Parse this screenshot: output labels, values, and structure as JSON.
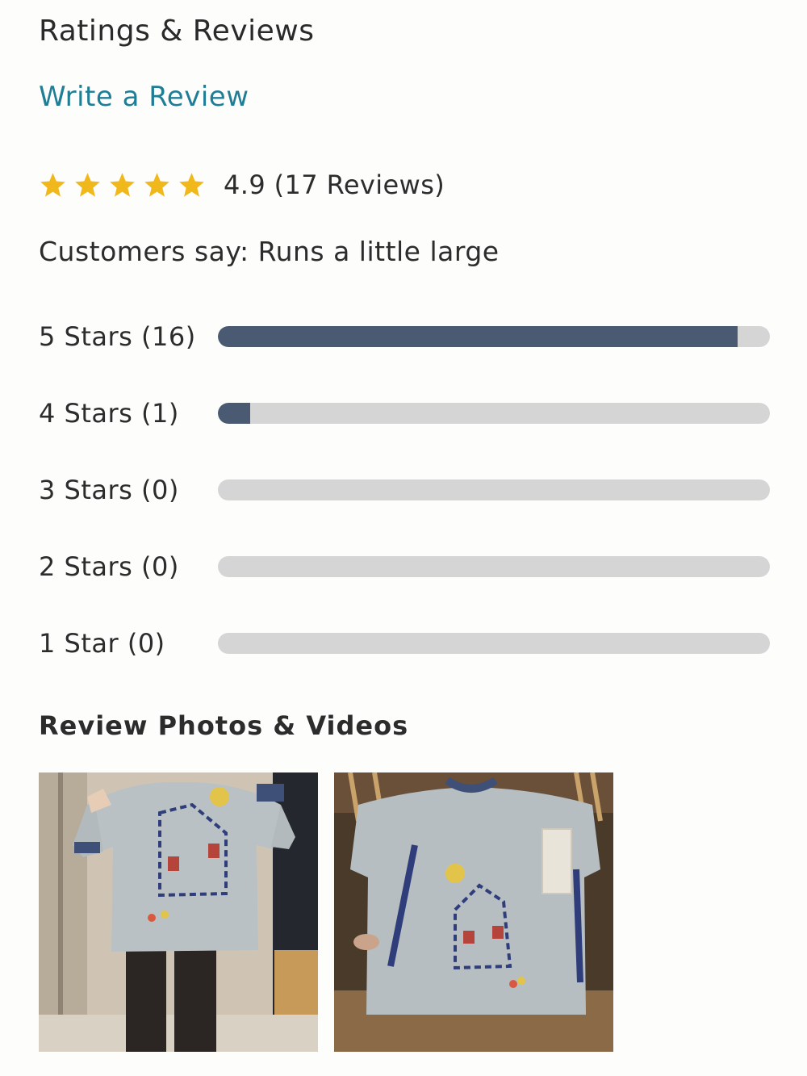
{
  "header": {
    "title": "Ratings & Reviews",
    "write_review_label": "Write a Review"
  },
  "rating": {
    "average": 4.9,
    "stars_filled": 5,
    "summary_text": "4.9 (17 Reviews)",
    "star_color": "#f0b81a"
  },
  "fit": {
    "text": "Customers say: Runs a little large"
  },
  "distribution": {
    "total": 17,
    "bar_color": "#4a5a72",
    "track_color": "#d5d5d5",
    "rows": [
      {
        "label": "5 Stars (16)",
        "stars": 5,
        "count": 16
      },
      {
        "label": "4 Stars (1)",
        "stars": 4,
        "count": 1
      },
      {
        "label": "3 Stars (0)",
        "stars": 3,
        "count": 0
      },
      {
        "label": "2 Stars (0)",
        "stars": 2,
        "count": 0
      },
      {
        "label": "1 Star (0)",
        "stars": 1,
        "count": 0
      }
    ]
  },
  "media": {
    "heading": "Review Photos & Videos",
    "photos": [
      {
        "name": "review-photo-worn-sweater"
      },
      {
        "name": "review-photo-sweater-on-hanger"
      }
    ]
  }
}
